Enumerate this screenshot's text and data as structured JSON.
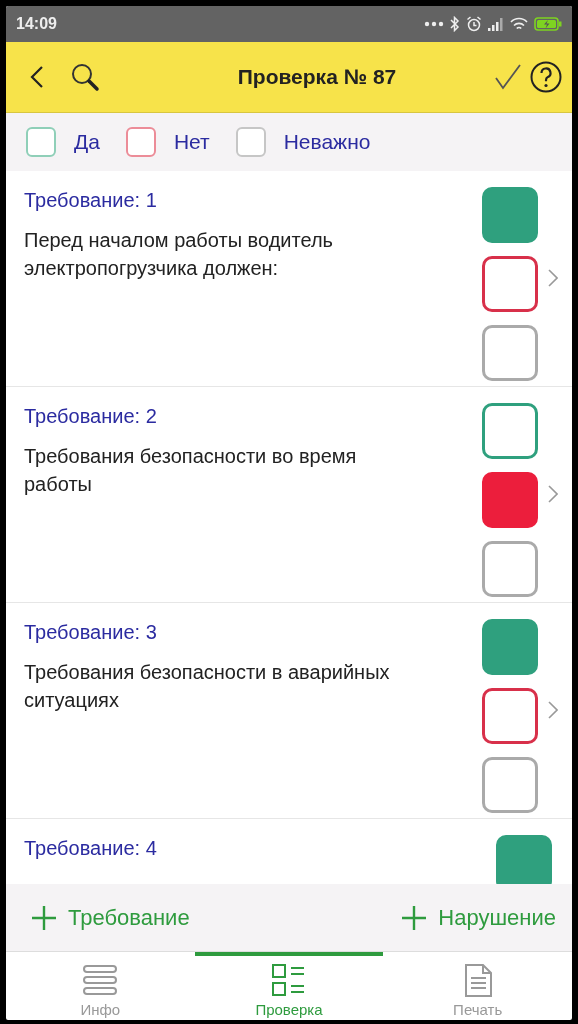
{
  "status_bar": {
    "time": "14:09"
  },
  "header": {
    "title": "Проверка № 87"
  },
  "legend": [
    {
      "kind": "yes",
      "label": "Да"
    },
    {
      "kind": "no",
      "label": "Нет"
    },
    {
      "kind": "na",
      "label": "Неважно"
    }
  ],
  "requirements": [
    {
      "heading": "Требование: 1",
      "text": "Перед началом работы водитель электропогрузчика должен:",
      "answers": [
        {
          "kind": "yes",
          "selected": true
        },
        {
          "kind": "no",
          "selected": false
        },
        {
          "kind": "na",
          "selected": false
        }
      ]
    },
    {
      "heading": "Требование: 2",
      "text": "Требования безопасности во время работы",
      "answers": [
        {
          "kind": "yes",
          "selected": false
        },
        {
          "kind": "no",
          "selected": true
        },
        {
          "kind": "na",
          "selected": false
        }
      ]
    },
    {
      "heading": "Требование: 3",
      "text": "Требования безопасности в аварийных ситуациях",
      "answers": [
        {
          "kind": "yes",
          "selected": true
        },
        {
          "kind": "no",
          "selected": false
        },
        {
          "kind": "na",
          "selected": false
        }
      ]
    },
    {
      "heading": "Требование: 4",
      "answers": [
        {
          "kind": "yes",
          "selected": true
        }
      ]
    }
  ],
  "actions": [
    "Требование",
    "Нарушение"
  ],
  "tabs": [
    {
      "kind": "info",
      "label": "Инфо",
      "selected": false
    },
    {
      "kind": "check",
      "label": "Проверка",
      "selected": true
    },
    {
      "kind": "print",
      "label": "Печать",
      "selected": false
    }
  ]
}
